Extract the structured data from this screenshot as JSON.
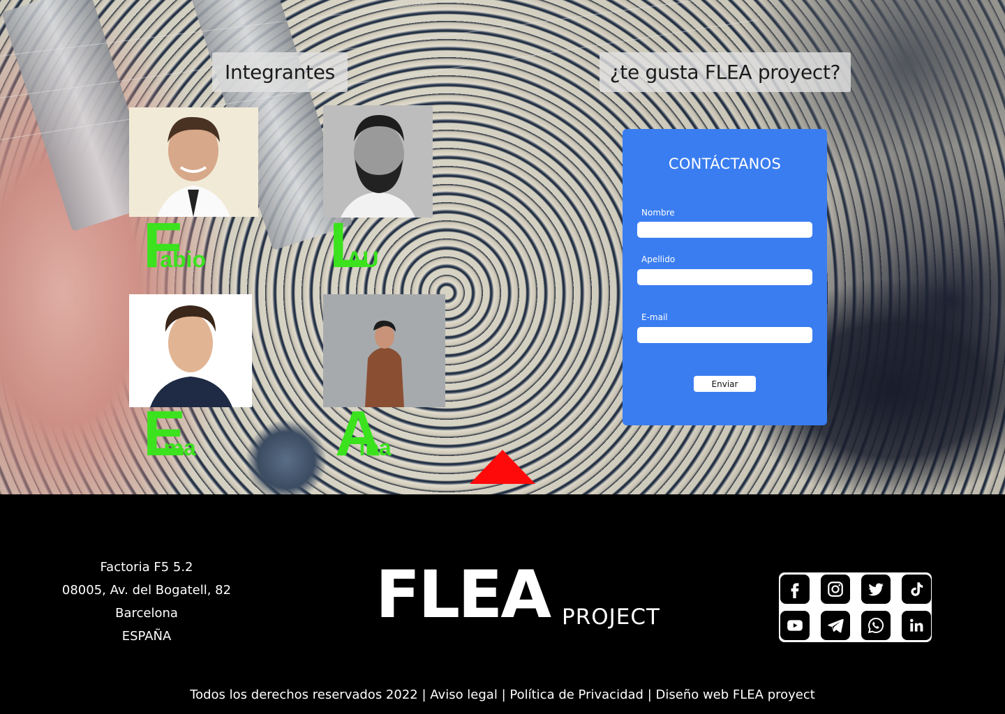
{
  "hero": {
    "members_title": "Integrantes",
    "contact_question": "¿te gusta FLEA proyect?"
  },
  "members": [
    {
      "initial": "F",
      "rest": "abio"
    },
    {
      "initial": "L",
      "rest": "AU"
    },
    {
      "initial": "E",
      "rest": "ma"
    },
    {
      "initial": "A",
      "rest": "lba"
    }
  ],
  "contact": {
    "title": "CONTÁCTANOS",
    "fields": [
      {
        "label": "Nombre",
        "value": ""
      },
      {
        "label": "Apellido",
        "value": ""
      },
      {
        "label": "E-mail",
        "value": ""
      }
    ],
    "submit_label": "Enviar"
  },
  "footer": {
    "address_lines": [
      "Factoria F5 5.2",
      "08005, Av. del Bogatell, 82",
      "Barcelona",
      "ESPAÑA"
    ],
    "logo_main": "FLEA",
    "logo_sub": "PROJECT",
    "social_icons": [
      "facebook-icon",
      "instagram-icon",
      "twitter-icon",
      "tiktok-icon",
      "youtube-icon",
      "telegram-icon",
      "whatsapp-icon",
      "linkedin-icon"
    ],
    "legal": {
      "rights": "Todos los derechos reservados 2022",
      "separator": "|",
      "notice": "Aviso legal",
      "privacy": "Política de Privacidad",
      "design": "Diseño web FLEA proyect"
    }
  },
  "colors": {
    "accent_green": "#3be21d",
    "form_blue": "#3a7df0",
    "arrow_red": "#ff0a0a"
  }
}
